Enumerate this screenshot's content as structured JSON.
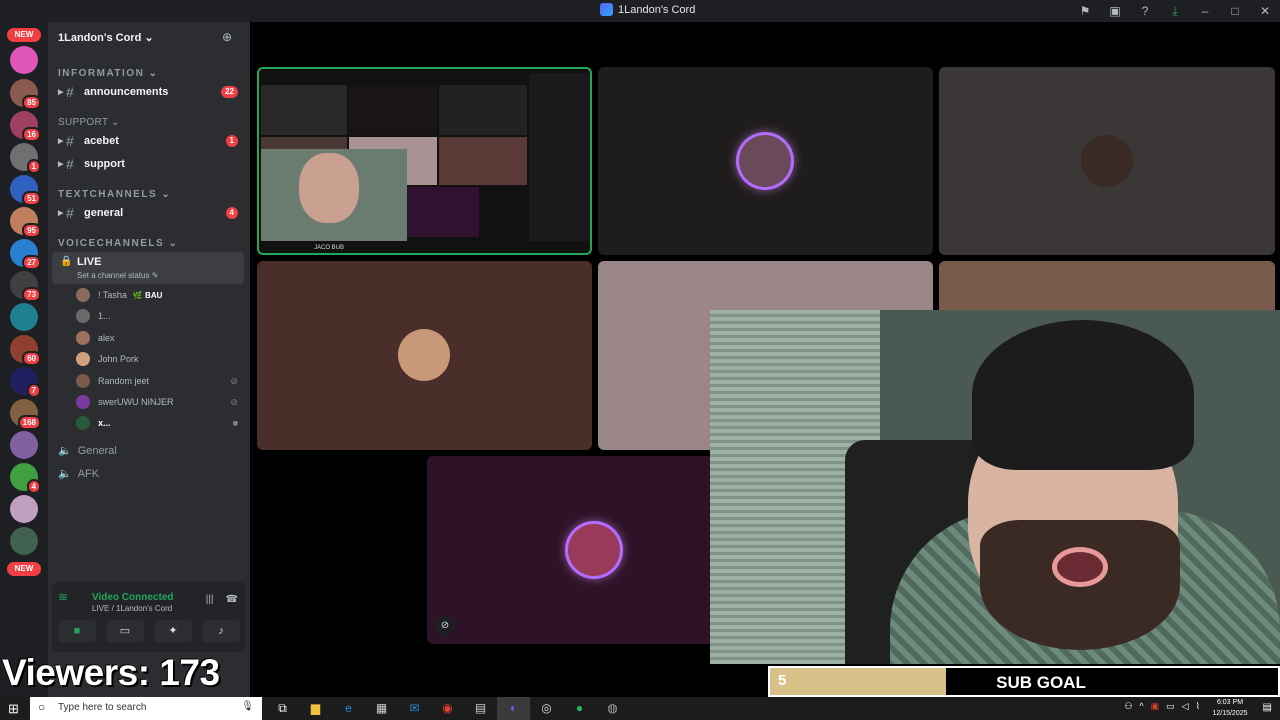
{
  "window": {
    "title": "1Landon's Cord"
  },
  "rail": {
    "new_top": "NEW",
    "new_bottom": "NEW",
    "badges": [
      "85",
      "16",
      "1",
      "51",
      "95",
      "27",
      "73",
      "60",
      "7",
      "168",
      "4"
    ]
  },
  "sidebar": {
    "server_name": "1Landon's Cord ⌄",
    "cat_information": "INFORMATION ⌄",
    "cat_support": "SUPPORT ⌄",
    "cat_text": "TEXTCHANNELS ⌄",
    "cat_voice": "VOICECHANNELS ⌄",
    "channels": [
      {
        "name": "announcements",
        "count": "22"
      },
      {
        "name": "acebet",
        "count": "1"
      },
      {
        "name": "support",
        "count": ""
      },
      {
        "name": "general",
        "count": "4"
      }
    ],
    "live": {
      "name": "LIVE",
      "status": "Set a channel status ✎"
    },
    "voice_users": [
      {
        "name": "! Tasha",
        "tag": "🌿 BAU",
        "color": "#8a6a5a"
      },
      {
        "name": "1...",
        "tag": "",
        "color": "#6a6a6a"
      },
      {
        "name": "alex",
        "tag": "",
        "color": "#a07060"
      },
      {
        "name": "John Pork",
        "tag": "",
        "color": "#d0a080"
      },
      {
        "name": "Random jeet",
        "tag": "",
        "color": "#7a5a4a"
      },
      {
        "name": "swerUWU NINJER",
        "tag": "",
        "color": "#7a3aa0"
      },
      {
        "name": "x...",
        "tag": "",
        "color": "#2a5a3a"
      }
    ],
    "voice_channels": [
      "General",
      "AFK"
    ]
  },
  "voice_panel": {
    "title": "Video Connected",
    "subtitle": "LIVE / 1Landon's Cord"
  },
  "overlay": {
    "viewers": "Viewers: 173",
    "subgoal_count": "5",
    "subgoal_label": "SUB GOAL",
    "subgoal_progress": 0.34,
    "screen_share_tag": "JACO BUB"
  },
  "taskbar": {
    "search_placeholder": "Type here to search",
    "time": "6:03 PM",
    "date": "12/15/2025"
  },
  "colors": {
    "accent": "#23a55a",
    "danger": "#f23f43",
    "tile_dark": "#1f1c1c",
    "tile_gray": "#3a3736",
    "tile_brown": "#4a2e2a",
    "tile_pink": "#9a8588",
    "tile_tan": "#7a5a4c",
    "tile_purple": "#2e1227"
  }
}
